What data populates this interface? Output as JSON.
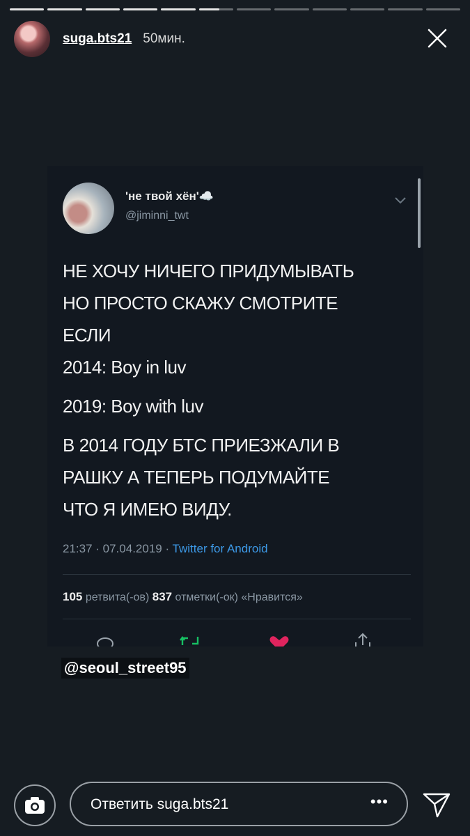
{
  "story": {
    "progress": {
      "segments": 12,
      "completed": 5,
      "current_fill": 0.6
    }
  },
  "header": {
    "username": "suga.bts21",
    "time": "50мин."
  },
  "tweet": {
    "display_name": "'не твой хён'☁️",
    "handle": "@jiminni_twt",
    "lines": [
      "НЕ ХОЧУ НИЧЕГО ПРИДУМЫВАТЬ",
      "НО ПРОСТО СКАЖУ СМОТРИТЕ",
      "ЕСЛИ",
      "2014: Boy in luv",
      "2019: Boy with luv",
      "В 2014 ГОДУ БТС ПРИЕЗЖАЛИ В",
      "РАШКУ А ТЕПЕРЬ ПОДУМАЙТЕ",
      "ЧТО Я ИМЕЮ ВИДУ."
    ],
    "timestamp": "21:37 · 07.04.2019 · ",
    "source": "Twitter for Android",
    "retweets_count": "105",
    "retweets_label": " ретвита(-ов)  ",
    "likes_count": "837",
    "likes_label": " отметки(-ок) «Нравится»"
  },
  "mention": "@seoul_street95",
  "footer": {
    "reply_placeholder": "Ответить suga.bts21",
    "more": "•••"
  },
  "colors": {
    "background": "#161c22",
    "link": "#3d9ae8",
    "like": "#e0245e",
    "retweet": "#17bf63"
  }
}
